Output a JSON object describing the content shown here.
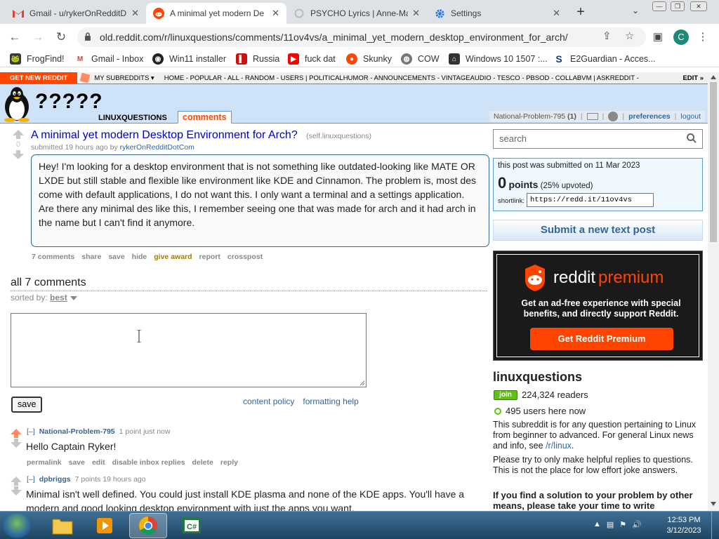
{
  "browser": {
    "tabs": [
      {
        "label": "Gmail - u/rykerOnRedditD",
        "icon": "gmail-icon",
        "active": false
      },
      {
        "label": "A minimal yet modern De",
        "icon": "reddit-icon",
        "active": true
      },
      {
        "label": "PSYCHO Lyrics | Anne-Ma",
        "icon": "loading-icon",
        "active": false
      },
      {
        "label": "Settings",
        "icon": "gear-icon",
        "active": false
      }
    ],
    "url": "old.reddit.com/r/linuxquestions/comments/11ov4vs/a_minimal_yet_modern_desktop_environment_for_arch/",
    "profile_initial": "C",
    "bookmarks": [
      {
        "label": "FrogFind!",
        "icon": "frog-icon",
        "color": "#333333"
      },
      {
        "label": "Gmail - Inbox",
        "icon": "gmail-icon",
        "color": "#d44638"
      },
      {
        "label": "Win11 installer",
        "icon": "github-icon",
        "color": "#222222"
      },
      {
        "label": "Russia",
        "icon": "bookmark-icon",
        "color": "#cc1111"
      },
      {
        "label": "fuck dat",
        "icon": "youtube-icon",
        "color": "#ff0000"
      },
      {
        "label": "Skunky",
        "icon": "reddit-icon",
        "color": "#ff4500"
      },
      {
        "label": "COW",
        "icon": "globe-icon",
        "color": "#555555"
      },
      {
        "label": "Windows 10 1507 :...",
        "icon": "archive-icon",
        "color": "#333333"
      },
      {
        "label": "E2Guardian - Acces...",
        "icon": "e2-icon",
        "color": "#1a3b8a"
      }
    ]
  },
  "reddit": {
    "srbar": {
      "get_new": "GET NEW REDDIT",
      "my_subreddits": "MY SUBREDDITS",
      "links": "HOME - POPULAR - ALL - RANDOM - USERS | POLITICALHUMOR - ANNOUNCEMENTS - VINTAGEAUDIO - TESCO - PBSOD - COLLABVM | ASKREDDIT -",
      "edit": "EDIT »"
    },
    "header": {
      "title": "?????",
      "subreddit": "LINUXQUESTIONS",
      "tab": "comments",
      "username": "National-Problem-795",
      "karma": "(1)",
      "preferences": "preferences",
      "logout": "logout"
    },
    "post": {
      "score": "0",
      "title": "A minimal yet modern Desktop Environment for Arch?",
      "domain": "(self.linuxquestions)",
      "submitted": "submitted 19 hours ago by",
      "author": "rykerOnRedditDotCom",
      "body": "Hey! I'm looking for a desktop environment that is not something like outdated-looking like MATE OR LXDE but still stable and flexible like environment like KDE and Cinnamon. The problem is, most des come with default applications, I do not want this. I only want a terminal and a settings application. Are there any minimal des like this, I remember seeing one that was made for arch and it had arch in the name but I can't find it anymore.",
      "actions": [
        "7 comments",
        "share",
        "save",
        "hide",
        "give award",
        "report",
        "crosspost"
      ]
    },
    "comments_header": {
      "title": "all 7 comments",
      "sorted_label": "sorted by:",
      "sort": "best"
    },
    "comment_form": {
      "save": "save",
      "content_policy": "content policy",
      "formatting_help": "formatting help"
    },
    "comments": [
      {
        "expand": "[–]",
        "author": "National-Problem-795",
        "meta": "1 point just now",
        "body": "Hello Captain Ryker!",
        "actions": [
          "permalink",
          "save",
          "edit",
          "disable inbox replies",
          "delete",
          "reply"
        ]
      },
      {
        "expand": "[–]",
        "author": "dpbriggs",
        "meta": "7 points 19 hours ago",
        "body": "Minimal isn't well defined. You could just install KDE plasma and none of the KDE apps. You'll have a modern and good looking desktop environment with just the apps you want.",
        "actions": []
      }
    ],
    "sidebar": {
      "search_placeholder": "search",
      "submitted_on": "this post was submitted on 11 Mar 2023",
      "points": "0",
      "points_label": "points",
      "upvoted": "(25% upvoted)",
      "shortlink_label": "shortlink:",
      "shortlink": "https://redd.it/11ov4vs",
      "submit_text": "Submit a new text post",
      "premium_logo": "reddit",
      "premium_word": "premium",
      "premium_desc": "Get an ad-free experience with special benefits, and directly support Reddit.",
      "premium_button": "Get Reddit Premium",
      "subreddit_title": "linuxquestions",
      "join": "join",
      "readers": "224,324 readers",
      "online": "495 users here now",
      "desc1": "This subreddit is for any question pertaining to Linux from beginner to advanced. For general Linux news and info, see",
      "desc1_link": "/r/linux",
      "desc1_end": ".",
      "desc2": "Please try to only make helpful replies to questions. This is not the place for low effort joke answers.",
      "desc3": "If you find a solution to your problem by other means, please take your time to write"
    }
  },
  "taskbar": {
    "time": "12:53 PM",
    "date": "3/12/2023"
  },
  "colors": {
    "reddit_orange": "#ff4500",
    "link_blue": "#336699",
    "header_blue": "#cee3f8"
  }
}
